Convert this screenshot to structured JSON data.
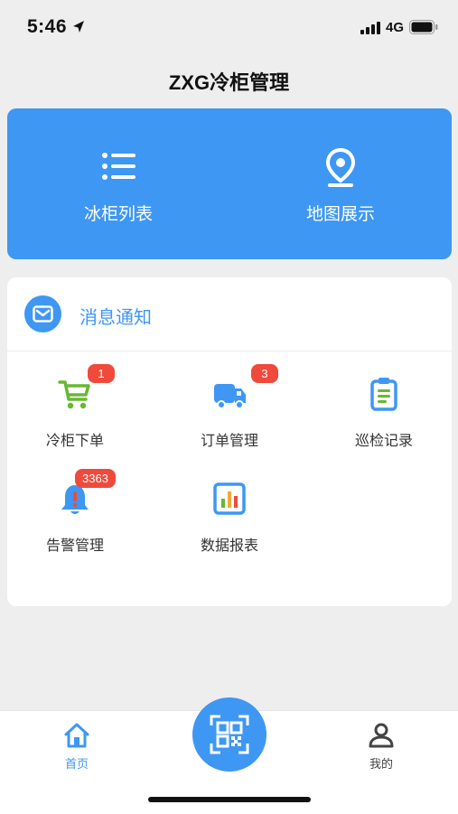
{
  "status_bar": {
    "time": "5:46",
    "network": "4G"
  },
  "header": {
    "title": "ZXG冷柜管理"
  },
  "quick_actions": [
    {
      "label": "冰柜列表",
      "icon": "list-icon"
    },
    {
      "label": "地图展示",
      "icon": "map-pin-icon"
    }
  ],
  "notice": {
    "label": "消息通知",
    "icon": "mail-icon"
  },
  "features": [
    {
      "label": "冷柜下单",
      "icon": "cart-icon",
      "badge": "1"
    },
    {
      "label": "订单管理",
      "icon": "truck-icon",
      "badge": "3"
    },
    {
      "label": "巡检记录",
      "icon": "clipboard-icon"
    },
    {
      "label": "告警管理",
      "icon": "alarm-bell-icon",
      "badge": "3363"
    },
    {
      "label": "数据报表",
      "icon": "report-chart-icon"
    }
  ],
  "tabbar": {
    "home_label": "首页",
    "mine_label": "我的",
    "scan_icon": "qr-scan-icon"
  },
  "colors": {
    "primary": "#3e97f3",
    "badge": "#ef4a3c",
    "cart": "#67b832",
    "page_bg": "#eeeeee"
  }
}
